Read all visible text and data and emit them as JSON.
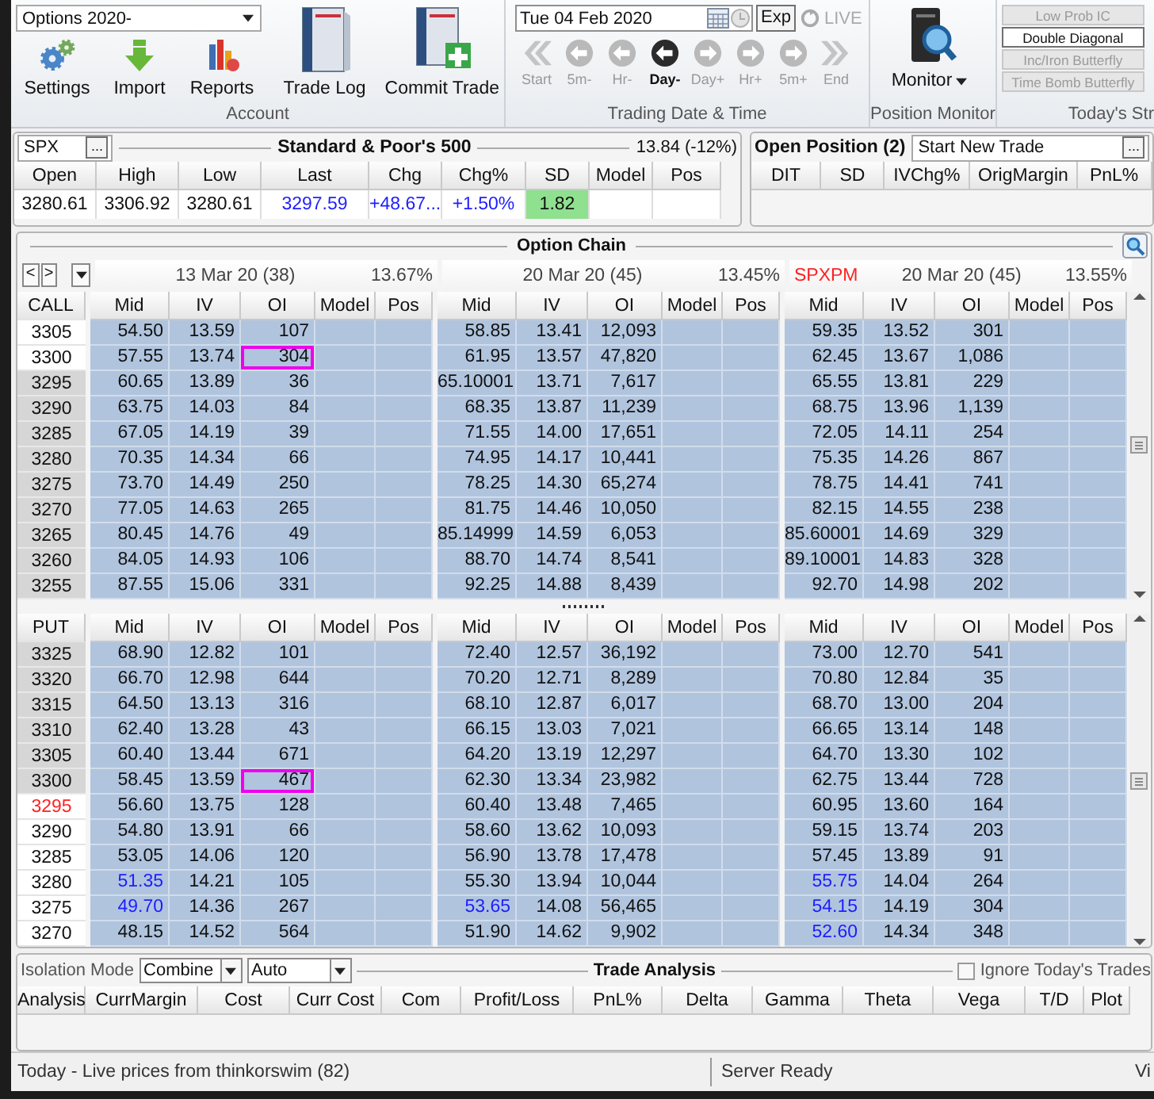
{
  "ribbon": {
    "account": {
      "selector": "Options 2020-",
      "small_buttons": [
        {
          "label": "Settings",
          "kind": "gear"
        },
        {
          "label": "Import",
          "kind": "import"
        },
        {
          "label": "Reports",
          "kind": "chart"
        }
      ],
      "big_buttons": [
        {
          "label": "Trade Log",
          "kind": "book"
        },
        {
          "label": "Commit Trade",
          "kind": "book-plus"
        }
      ],
      "group_label": "Account"
    },
    "trading_date": {
      "date": "Tue 04 Feb 2020",
      "exp_button": "Exp",
      "live": "LIVE",
      "group_label": "Trading Date & Time",
      "steps": [
        {
          "label": "Start",
          "kind": "chevron-left",
          "selected": false
        },
        {
          "label": "5m-",
          "kind": "circle-left",
          "selected": false
        },
        {
          "label": "Hr-",
          "kind": "circle-left",
          "selected": false
        },
        {
          "label": "Day-",
          "kind": "circle-left",
          "selected": true
        },
        {
          "label": "Day+",
          "kind": "circle-right",
          "selected": false
        },
        {
          "label": "Hr+",
          "kind": "circle-right",
          "selected": false
        },
        {
          "label": "5m+",
          "kind": "circle-right",
          "selected": false
        },
        {
          "label": "End",
          "kind": "chevron-right",
          "selected": false
        }
      ]
    },
    "monitor": {
      "label": "Monitor",
      "group_label": "Position Monitor"
    },
    "strategies": {
      "group_label": "Today's Str",
      "buttons": [
        {
          "label": "Low Prob IC",
          "disabled": true
        },
        {
          "label": "Double Diagonal",
          "disabled": false
        },
        {
          "label": "Inc/Iron Butterfly",
          "disabled": true
        },
        {
          "label": "Time Bomb Butterfly",
          "disabled": true
        }
      ]
    }
  },
  "quote": {
    "symbol": "SPX",
    "browse_button": "...",
    "title": "Standard & Poor's 500",
    "iv": "13.84 (-12%)",
    "columns": [
      "Open",
      "High",
      "Low",
      "Last",
      "Chg",
      "Chg%",
      "SD",
      "Model",
      "Pos"
    ],
    "values": [
      {
        "text": "3280.61",
        "kind": "plain"
      },
      {
        "text": "3306.92",
        "kind": "plain"
      },
      {
        "text": "3280.61",
        "kind": "plain"
      },
      {
        "text": "3297.59",
        "kind": "blue"
      },
      {
        "text": "+48.67...",
        "kind": "blue"
      },
      {
        "text": "+1.50%",
        "kind": "blue"
      },
      {
        "text": "1.82",
        "kind": "green"
      }
    ]
  },
  "open_position": {
    "title": "Open Position (2)",
    "trade_selector": "Start New Trade",
    "browse_button": "...",
    "columns": [
      "DIT",
      "SD",
      "IVChg%",
      "OrigMargin",
      "PnL%"
    ]
  },
  "option_chain": {
    "title": "Option Chain",
    "nav": [
      "<",
      ">"
    ],
    "expirations": [
      {
        "date": "13 Mar 20 (38)",
        "iv": "13.67%"
      },
      {
        "date": "20 Mar 20 (45)",
        "iv": "13.45%"
      },
      {
        "root": "SPXPM",
        "date": "20 Mar 20 (45)",
        "iv": "13.55%"
      }
    ],
    "calls": {
      "label": "CALL",
      "column_groups": [
        [
          "Mid",
          "IV",
          "OI",
          "Model",
          "Pos"
        ],
        [
          "Mid",
          "IV",
          "OI",
          "Model",
          "Pos"
        ],
        [
          "Mid",
          "IV",
          "OI",
          "Model",
          "Pos"
        ]
      ],
      "rows": [
        {
          "strike": "3305",
          "itm": false,
          "atm": false,
          "quotes": [
            {
              "mid": "54.50",
              "iv": "13.59",
              "oi": "107",
              "mid_blue": false,
              "oi_marked": false
            },
            {
              "mid": "58.85",
              "iv": "13.41",
              "oi": "12,093",
              "mid_blue": false,
              "oi_marked": false
            },
            {
              "mid": "59.35",
              "iv": "13.52",
              "oi": "301",
              "mid_blue": false,
              "oi_marked": false
            }
          ]
        },
        {
          "strike": "3300",
          "itm": false,
          "atm": false,
          "quotes": [
            {
              "mid": "57.55",
              "iv": "13.74",
              "oi": "304",
              "mid_blue": false,
              "oi_marked": true
            },
            {
              "mid": "61.95",
              "iv": "13.57",
              "oi": "47,820",
              "mid_blue": false,
              "oi_marked": false
            },
            {
              "mid": "62.45",
              "iv": "13.67",
              "oi": "1,086",
              "mid_blue": false,
              "oi_marked": false
            }
          ]
        },
        {
          "strike": "3295",
          "itm": true,
          "atm": false,
          "quotes": [
            {
              "mid": "60.65",
              "iv": "13.89",
              "oi": "36",
              "mid_blue": false,
              "oi_marked": false
            },
            {
              "mid": "65.10001",
              "iv": "13.71",
              "oi": "7,617",
              "mid_blue": false,
              "oi_marked": false
            },
            {
              "mid": "65.55",
              "iv": "13.81",
              "oi": "229",
              "mid_blue": false,
              "oi_marked": false
            }
          ]
        },
        {
          "strike": "3290",
          "itm": true,
          "atm": false,
          "quotes": [
            {
              "mid": "63.75",
              "iv": "14.03",
              "oi": "84",
              "mid_blue": false,
              "oi_marked": false
            },
            {
              "mid": "68.35",
              "iv": "13.87",
              "oi": "11,239",
              "mid_blue": false,
              "oi_marked": false
            },
            {
              "mid": "68.75",
              "iv": "13.96",
              "oi": "1,139",
              "mid_blue": false,
              "oi_marked": false
            }
          ]
        },
        {
          "strike": "3285",
          "itm": true,
          "atm": false,
          "quotes": [
            {
              "mid": "67.05",
              "iv": "14.19",
              "oi": "39",
              "mid_blue": false,
              "oi_marked": false
            },
            {
              "mid": "71.55",
              "iv": "14.00",
              "oi": "17,651",
              "mid_blue": false,
              "oi_marked": false
            },
            {
              "mid": "72.05",
              "iv": "14.11",
              "oi": "254",
              "mid_blue": false,
              "oi_marked": false
            }
          ]
        },
        {
          "strike": "3280",
          "itm": true,
          "atm": false,
          "quotes": [
            {
              "mid": "70.35",
              "iv": "14.34",
              "oi": "66",
              "mid_blue": false,
              "oi_marked": false
            },
            {
              "mid": "74.95",
              "iv": "14.17",
              "oi": "10,441",
              "mid_blue": false,
              "oi_marked": false
            },
            {
              "mid": "75.35",
              "iv": "14.26",
              "oi": "867",
              "mid_blue": false,
              "oi_marked": false
            }
          ]
        },
        {
          "strike": "3275",
          "itm": true,
          "atm": false,
          "quotes": [
            {
              "mid": "73.70",
              "iv": "14.49",
              "oi": "250",
              "mid_blue": false,
              "oi_marked": false
            },
            {
              "mid": "78.25",
              "iv": "14.30",
              "oi": "65,274",
              "mid_blue": false,
              "oi_marked": false
            },
            {
              "mid": "78.75",
              "iv": "14.41",
              "oi": "741",
              "mid_blue": false,
              "oi_marked": false
            }
          ]
        },
        {
          "strike": "3270",
          "itm": true,
          "atm": false,
          "quotes": [
            {
              "mid": "77.05",
              "iv": "14.63",
              "oi": "265",
              "mid_blue": false,
              "oi_marked": false
            },
            {
              "mid": "81.75",
              "iv": "14.46",
              "oi": "10,050",
              "mid_blue": false,
              "oi_marked": false
            },
            {
              "mid": "82.15",
              "iv": "14.55",
              "oi": "238",
              "mid_blue": false,
              "oi_marked": false
            }
          ]
        },
        {
          "strike": "3265",
          "itm": true,
          "atm": false,
          "quotes": [
            {
              "mid": "80.45",
              "iv": "14.76",
              "oi": "49",
              "mid_blue": false,
              "oi_marked": false
            },
            {
              "mid": "85.14999",
              "iv": "14.59",
              "oi": "6,053",
              "mid_blue": false,
              "oi_marked": false
            },
            {
              "mid": "85.60001",
              "iv": "14.69",
              "oi": "329",
              "mid_blue": false,
              "oi_marked": false
            }
          ]
        },
        {
          "strike": "3260",
          "itm": true,
          "atm": false,
          "quotes": [
            {
              "mid": "84.05",
              "iv": "14.93",
              "oi": "106",
              "mid_blue": false,
              "oi_marked": false
            },
            {
              "mid": "88.70",
              "iv": "14.74",
              "oi": "8,541",
              "mid_blue": false,
              "oi_marked": false
            },
            {
              "mid": "89.10001",
              "iv": "14.83",
              "oi": "328",
              "mid_blue": false,
              "oi_marked": false
            }
          ]
        },
        {
          "strike": "3255",
          "itm": true,
          "atm": false,
          "quotes": [
            {
              "mid": "87.55",
              "iv": "15.06",
              "oi": "331",
              "mid_blue": false,
              "oi_marked": false
            },
            {
              "mid": "92.25",
              "iv": "14.88",
              "oi": "8,439",
              "mid_blue": false,
              "oi_marked": false
            },
            {
              "mid": "92.70",
              "iv": "14.98",
              "oi": "202",
              "mid_blue": false,
              "oi_marked": false
            }
          ]
        }
      ]
    },
    "puts": {
      "label": "PUT",
      "column_groups": [
        [
          "Mid",
          "IV",
          "OI",
          "Model",
          "Pos"
        ],
        [
          "Mid",
          "IV",
          "OI",
          "Model",
          "Pos"
        ],
        [
          "Mid",
          "IV",
          "OI",
          "Model",
          "Pos"
        ]
      ],
      "rows": [
        {
          "strike": "3325",
          "itm": true,
          "atm": false,
          "quotes": [
            {
              "mid": "68.90",
              "iv": "12.82",
              "oi": "101",
              "mid_blue": false,
              "oi_marked": false
            },
            {
              "mid": "72.40",
              "iv": "12.57",
              "oi": "36,192",
              "mid_blue": false,
              "oi_marked": false
            },
            {
              "mid": "73.00",
              "iv": "12.70",
              "oi": "541",
              "mid_blue": false,
              "oi_marked": false
            }
          ]
        },
        {
          "strike": "3320",
          "itm": true,
          "atm": false,
          "quotes": [
            {
              "mid": "66.70",
              "iv": "12.98",
              "oi": "644",
              "mid_blue": false,
              "oi_marked": false
            },
            {
              "mid": "70.20",
              "iv": "12.71",
              "oi": "8,289",
              "mid_blue": false,
              "oi_marked": false
            },
            {
              "mid": "70.80",
              "iv": "12.84",
              "oi": "35",
              "mid_blue": false,
              "oi_marked": false
            }
          ]
        },
        {
          "strike": "3315",
          "itm": true,
          "atm": false,
          "quotes": [
            {
              "mid": "64.50",
              "iv": "13.13",
              "oi": "316",
              "mid_blue": false,
              "oi_marked": false
            },
            {
              "mid": "68.10",
              "iv": "12.87",
              "oi": "6,017",
              "mid_blue": false,
              "oi_marked": false
            },
            {
              "mid": "68.70",
              "iv": "13.00",
              "oi": "204",
              "mid_blue": false,
              "oi_marked": false
            }
          ]
        },
        {
          "strike": "3310",
          "itm": true,
          "atm": false,
          "quotes": [
            {
              "mid": "62.40",
              "iv": "13.28",
              "oi": "43",
              "mid_blue": false,
              "oi_marked": false
            },
            {
              "mid": "66.15",
              "iv": "13.03",
              "oi": "7,021",
              "mid_blue": false,
              "oi_marked": false
            },
            {
              "mid": "66.65",
              "iv": "13.14",
              "oi": "148",
              "mid_blue": false,
              "oi_marked": false
            }
          ]
        },
        {
          "strike": "3305",
          "itm": true,
          "atm": false,
          "quotes": [
            {
              "mid": "60.40",
              "iv": "13.44",
              "oi": "671",
              "mid_blue": false,
              "oi_marked": false
            },
            {
              "mid": "64.20",
              "iv": "13.19",
              "oi": "12,297",
              "mid_blue": false,
              "oi_marked": false
            },
            {
              "mid": "64.70",
              "iv": "13.30",
              "oi": "102",
              "mid_blue": false,
              "oi_marked": false
            }
          ]
        },
        {
          "strike": "3300",
          "itm": true,
          "atm": false,
          "quotes": [
            {
              "mid": "58.45",
              "iv": "13.59",
              "oi": "467",
              "mid_blue": false,
              "oi_marked": true
            },
            {
              "mid": "62.30",
              "iv": "13.34",
              "oi": "23,982",
              "mid_blue": false,
              "oi_marked": false
            },
            {
              "mid": "62.75",
              "iv": "13.44",
              "oi": "728",
              "mid_blue": false,
              "oi_marked": false
            }
          ]
        },
        {
          "strike": "3295",
          "itm": false,
          "atm": true,
          "quotes": [
            {
              "mid": "56.60",
              "iv": "13.75",
              "oi": "128",
              "mid_blue": false,
              "oi_marked": false
            },
            {
              "mid": "60.40",
              "iv": "13.48",
              "oi": "7,465",
              "mid_blue": false,
              "oi_marked": false
            },
            {
              "mid": "60.95",
              "iv": "13.60",
              "oi": "164",
              "mid_blue": false,
              "oi_marked": false
            }
          ]
        },
        {
          "strike": "3290",
          "itm": false,
          "atm": false,
          "quotes": [
            {
              "mid": "54.80",
              "iv": "13.91",
              "oi": "66",
              "mid_blue": false,
              "oi_marked": false
            },
            {
              "mid": "58.60",
              "iv": "13.62",
              "oi": "10,093",
              "mid_blue": false,
              "oi_marked": false
            },
            {
              "mid": "59.15",
              "iv": "13.74",
              "oi": "203",
              "mid_blue": false,
              "oi_marked": false
            }
          ]
        },
        {
          "strike": "3285",
          "itm": false,
          "atm": false,
          "quotes": [
            {
              "mid": "53.05",
              "iv": "14.06",
              "oi": "120",
              "mid_blue": false,
              "oi_marked": false
            },
            {
              "mid": "56.90",
              "iv": "13.78",
              "oi": "17,478",
              "mid_blue": false,
              "oi_marked": false
            },
            {
              "mid": "57.45",
              "iv": "13.89",
              "oi": "91",
              "mid_blue": false,
              "oi_marked": false
            }
          ]
        },
        {
          "strike": "3280",
          "itm": false,
          "atm": false,
          "quotes": [
            {
              "mid": "51.35",
              "iv": "14.21",
              "oi": "105",
              "mid_blue": true,
              "oi_marked": false
            },
            {
              "mid": "55.30",
              "iv": "13.94",
              "oi": "10,044",
              "mid_blue": false,
              "oi_marked": false
            },
            {
              "mid": "55.75",
              "iv": "14.04",
              "oi": "264",
              "mid_blue": true,
              "oi_marked": false
            }
          ]
        },
        {
          "strike": "3275",
          "itm": false,
          "atm": false,
          "quotes": [
            {
              "mid": "49.70",
              "iv": "14.36",
              "oi": "267",
              "mid_blue": true,
              "oi_marked": false
            },
            {
              "mid": "53.65",
              "iv": "14.08",
              "oi": "56,465",
              "mid_blue": true,
              "oi_marked": false
            },
            {
              "mid": "54.15",
              "iv": "14.19",
              "oi": "304",
              "mid_blue": true,
              "oi_marked": false
            }
          ]
        },
        {
          "strike": "3270",
          "itm": false,
          "atm": false,
          "quotes": [
            {
              "mid": "48.15",
              "iv": "14.52",
              "oi": "564",
              "mid_blue": false,
              "oi_marked": false
            },
            {
              "mid": "51.90",
              "iv": "14.62",
              "oi": "9,902",
              "mid_blue": false,
              "oi_marked": false
            },
            {
              "mid": "52.60",
              "iv": "14.34",
              "oi": "348",
              "mid_blue": true,
              "oi_marked": false
            }
          ]
        }
      ]
    }
  },
  "trade_analysis": {
    "isolation_label": "Isolation Mode",
    "mode": "Combine",
    "sub_mode": "Auto",
    "title": "Trade Analysis",
    "ignore_todays_trades": {
      "label": "Ignore Today's Trades",
      "checked": false
    },
    "columns": [
      "Analysis",
      "CurrMargin",
      "Cost",
      "Curr Cost",
      "Com",
      "Profit/Loss",
      "PnL%",
      "Delta",
      "Gamma",
      "Theta",
      "Vega",
      "T/D",
      "Plot"
    ]
  },
  "status_bar": {
    "message": "Today - Live prices from thinkorswim (82)",
    "server": "Server Ready",
    "extra": "Vi"
  }
}
